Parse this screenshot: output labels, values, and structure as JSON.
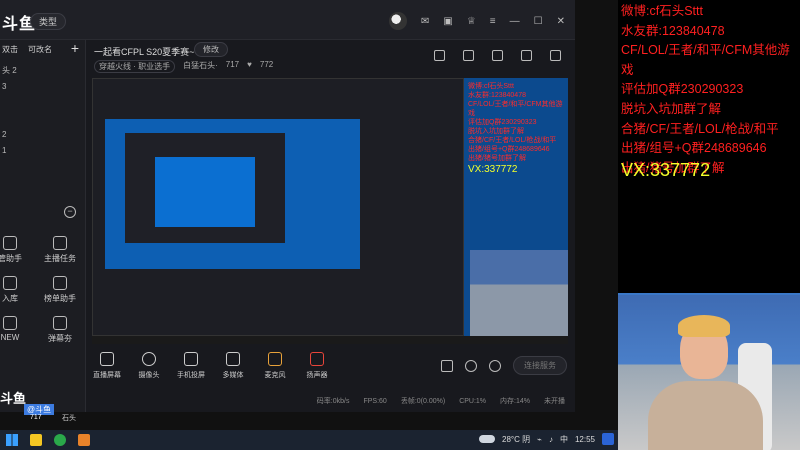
{
  "app": {
    "logo_text": "斗鱼",
    "type_pill": "类型",
    "sidebar": {
      "tab1": "双击",
      "tab2": "可改名",
      "plus": "+",
      "list": [
        "头 2",
        "3",
        "",
        "",
        "2",
        "1"
      ],
      "tools": [
        {
          "label": "主播任务",
          "icon": "task-icon"
        },
        {
          "label": "管助手",
          "icon": "assistant-icon"
        },
        {
          "label": "榜单助手",
          "icon": "rank-icon"
        },
        {
          "label": "入库",
          "icon": "download-icon"
        },
        {
          "label": "弹幕夯",
          "icon": "danmaku-icon"
        },
        {
          "label": "NEW",
          "icon": "new-icon"
        }
      ]
    },
    "room": {
      "title": "一起看CFPL S20夏季赛~",
      "edit_label": "修改",
      "category": "穿越火线 · 职业选手",
      "streamer": "白猛石头·",
      "viewers": "717",
      "likes": "772"
    },
    "toolbar": [
      {
        "label": "直播屏幕",
        "icon": "screen-icon"
      },
      {
        "label": "摄像头",
        "icon": "camera-icon"
      },
      {
        "label": "手机投屏",
        "icon": "phone-cast-icon"
      },
      {
        "label": "多媒体",
        "icon": "media-icon"
      },
      {
        "label": "麦克风",
        "icon": "mic-icon"
      },
      {
        "label": "扬声器",
        "icon": "speaker-icon"
      }
    ],
    "connect_label": "连接服务",
    "status": {
      "bitrate": "码率:0kb/s",
      "fps": "FPS:60",
      "drop": "丢帧:0(0.00%)",
      "cpu": "CPU:1%",
      "mem": "内存:14%",
      "state": "未开播"
    },
    "preview_text": {
      "lines": [
        "微博:cf石头Sttt",
        "水友群:123840478",
        "CF/LOL/王者/和平/CFM其他游戏",
        "评估加Q群230290323",
        "脱坑入坑加群了解",
        "合猪/CF/王者/LOL/枪战/和平",
        "出猪/组号+Q群248689646",
        "出猪/猪号加群了解"
      ],
      "vx": "VX:337772"
    }
  },
  "overlay": {
    "logo": "斗鱼",
    "badge": "@斗鱼",
    "count": "717",
    "sub": "石头"
  },
  "taskbar": {
    "weather": "28°C 阴",
    "ime": "中",
    "time": "12:55"
  },
  "right_panel": {
    "lines": [
      "微博:cf石头Sttt",
      "水友群:123840478",
      "CF/LOL/王者/和平/CFM其他游戏",
      "评估加Q群230290323",
      "脱坑入坑加群了解",
      "合猪/CF/王者/LOL/枪战/和平",
      "出猪/组号+Q群248689646",
      "出猪/猪号加群了解"
    ],
    "vx": "VX:337772"
  }
}
